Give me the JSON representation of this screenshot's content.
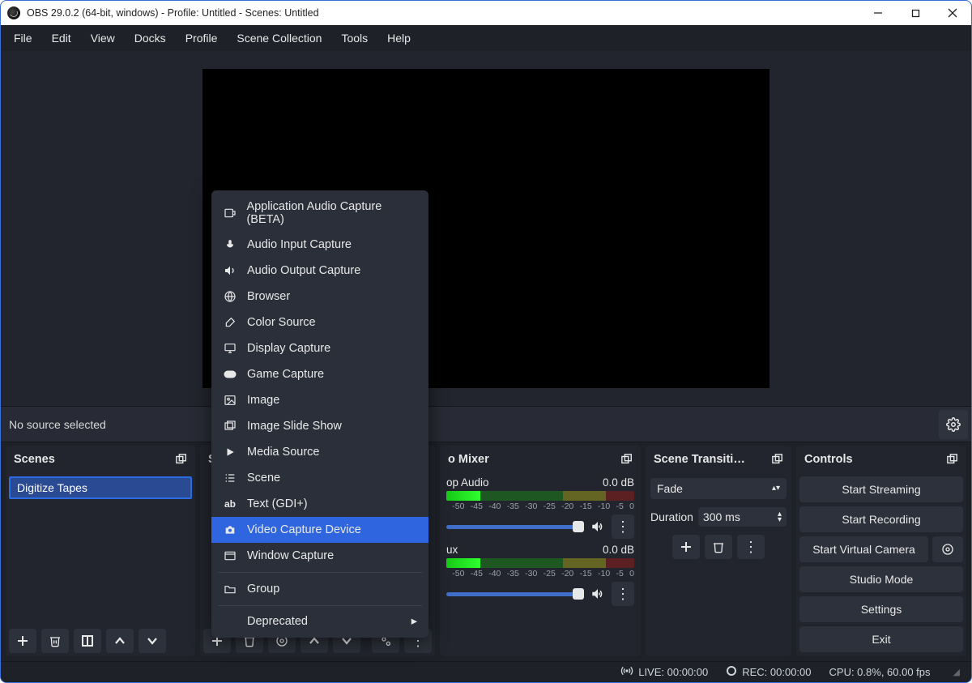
{
  "window_title": "OBS 29.0.2 (64-bit, windows) - Profile: Untitled - Scenes: Untitled",
  "menubar": [
    "File",
    "Edit",
    "View",
    "Docks",
    "Profile",
    "Scene Collection",
    "Tools",
    "Help"
  ],
  "context_bar": {
    "message": "No source selected"
  },
  "scenes": {
    "title": "Scenes",
    "items": [
      "Digitize Tapes"
    ]
  },
  "sources": {
    "title": "S"
  },
  "mixer": {
    "title": "o Mixer",
    "channels": [
      {
        "name": "op Audio",
        "db": "0.0 dB"
      },
      {
        "name": "ux",
        "db": "0.0 dB"
      }
    ],
    "ticks": [
      "",
      "-50",
      "-45",
      "-40",
      "-35",
      "-30",
      "-25",
      "-20",
      "-15",
      "-10",
      "-5",
      "0"
    ]
  },
  "transitions": {
    "title": "Scene Transiti…",
    "current": "Fade",
    "duration_label": "Duration",
    "duration_value": "300 ms"
  },
  "controls": {
    "title": "Controls",
    "buttons": {
      "stream": "Start Streaming",
      "record": "Start Recording",
      "vcam": "Start Virtual Camera",
      "studio": "Studio Mode",
      "settings": "Settings",
      "exit": "Exit"
    }
  },
  "statusbar": {
    "live": "LIVE: 00:00:00",
    "rec": "REC: 00:00:00",
    "cpu": "CPU: 0.8%, 60.00 fps"
  },
  "context_menu": {
    "items": [
      {
        "label": "Application Audio Capture (BETA)",
        "icon": "app-audio"
      },
      {
        "label": "Audio Input Capture",
        "icon": "mic"
      },
      {
        "label": "Audio Output Capture",
        "icon": "speaker"
      },
      {
        "label": "Browser",
        "icon": "globe"
      },
      {
        "label": "Color Source",
        "icon": "brush"
      },
      {
        "label": "Display Capture",
        "icon": "monitor"
      },
      {
        "label": "Game Capture",
        "icon": "gamepad"
      },
      {
        "label": "Image",
        "icon": "image"
      },
      {
        "label": "Image Slide Show",
        "icon": "slideshow"
      },
      {
        "label": "Media Source",
        "icon": "play"
      },
      {
        "label": "Scene",
        "icon": "list"
      },
      {
        "label": "Text (GDI+)",
        "icon": "text"
      },
      {
        "label": "Video Capture Device",
        "icon": "camera",
        "selected": true
      },
      {
        "label": "Window Capture",
        "icon": "window"
      }
    ],
    "group": "Group",
    "deprecated": "Deprecated"
  }
}
